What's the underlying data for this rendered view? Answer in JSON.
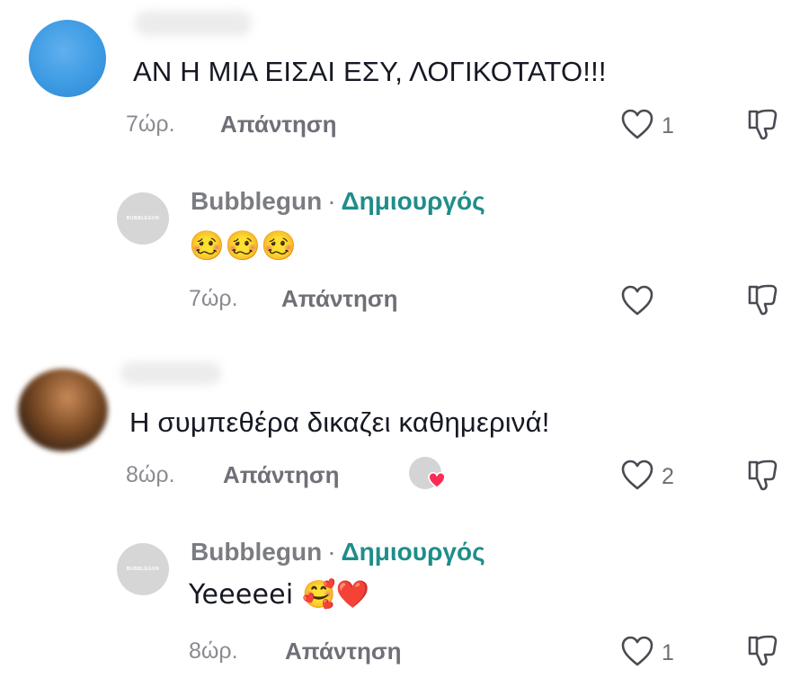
{
  "comments": [
    {
      "text": "ΑΝ Η ΜΙΑ ΕΙΣΑΙ ΕΣΥ, ΛΟΓΙΚΟΤΑΤΟ!!!",
      "time": "7ώρ.",
      "reply_label": "Απάντηση",
      "like_count": "1",
      "reply": {
        "author": "Bubblegun",
        "separator": "·",
        "role": "Δημιουργός",
        "avatar_text": "BUBBLEGUN",
        "text": "🥴🥴🥴",
        "time": "7ώρ.",
        "reply_label": "Απάντηση",
        "like_count": ""
      }
    },
    {
      "text": "Η συμπεθέρα δικαζει καθημερινά!",
      "time": "8ώρ.",
      "reply_label": "Απάντηση",
      "like_count": "2",
      "creator_liked": true,
      "reply": {
        "author": "Bubblegun",
        "separator": "·",
        "role": "Δημιουργός",
        "avatar_text": "BUBBLEGUN",
        "text": "Yeeeeei 🥰❤️",
        "time": "8ώρ.",
        "reply_label": "Απάντηση",
        "like_count": "1"
      }
    }
  ],
  "icons": {
    "like": "heart-outline-icon",
    "dislike": "thumbs-down-outline-icon",
    "creator_liked_badge": "heart-filled-icon"
  },
  "colors": {
    "role": "#1f8d8a",
    "liked_heart": "#fe2c55",
    "avatar1": "#3d9be3"
  }
}
